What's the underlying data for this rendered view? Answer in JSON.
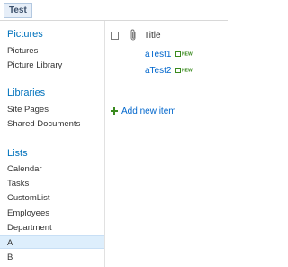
{
  "topbar": {
    "tab_label": "Test"
  },
  "sidebar": {
    "sections": [
      {
        "heading": "Pictures",
        "items": [
          "Pictures",
          "Picture Library"
        ]
      },
      {
        "heading": "Libraries",
        "items": [
          "Site Pages",
          "Shared Documents"
        ]
      },
      {
        "heading": "Lists",
        "items": [
          "Calendar",
          "Tasks",
          "CustomList",
          "Employees",
          "Department",
          "A",
          "B"
        ]
      }
    ],
    "selected_item": "A"
  },
  "list": {
    "column_title": "Title",
    "rows": [
      {
        "title": "aTest1",
        "badge": "NEW"
      },
      {
        "title": "aTest2",
        "badge": "NEW"
      }
    ],
    "add_label": "Add new item"
  },
  "colors": {
    "accent": "#0072bc",
    "link": "#0066cc",
    "new_badge": "#3a8a1e",
    "selected_bg": "#ddeefc"
  }
}
